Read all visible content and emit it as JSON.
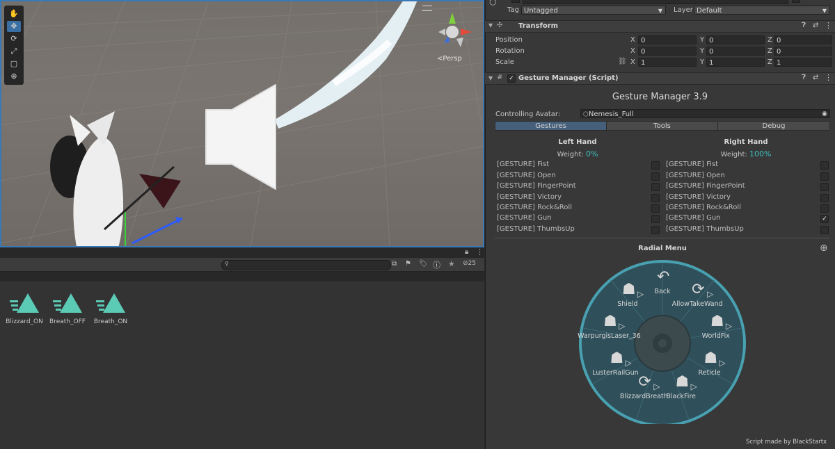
{
  "scene": {
    "persp_label": "Persp",
    "tools": [
      "hand-tool",
      "move-tool",
      "rotate-tool",
      "scale-tool",
      "rect-tool",
      "transform-tool"
    ]
  },
  "project": {
    "hidden_count": "25",
    "assets": [
      {
        "label": "Blizzard_ON"
      },
      {
        "label": "Breath_OFF"
      },
      {
        "label": "Breath_ON"
      }
    ]
  },
  "inspector": {
    "tag_label": "Tag",
    "tag_value": "Untagged",
    "layer_label": "Layer",
    "layer_value": "Default",
    "transform": {
      "title": "Transform",
      "rows": [
        {
          "label": "Position",
          "x": "0",
          "y": "0",
          "z": "0"
        },
        {
          "label": "Rotation",
          "x": "0",
          "y": "0",
          "z": "0"
        },
        {
          "label": "Scale",
          "x": "1",
          "y": "1",
          "z": "1"
        }
      ],
      "axis": {
        "x": "X",
        "y": "Y",
        "z": "Z"
      }
    },
    "gesture": {
      "component_title": "Gesture Manager (Script)",
      "heading": "Gesture Manager 3.9",
      "controlling_label": "Controlling Avatar:",
      "avatar_value": "Nemesis_Full",
      "tabs": [
        "Gestures",
        "Tools",
        "Debug"
      ],
      "left_hand": {
        "title": "Left Hand",
        "weight_label": "Weight:",
        "weight_value": "0%"
      },
      "right_hand": {
        "title": "Right Hand",
        "weight_label": "Weight:",
        "weight_value": "100%"
      },
      "left_gestures": [
        "[GESTURE] Fist",
        "[GESTURE] Open",
        "[GESTURE] FingerPoint",
        "[GESTURE] Victory",
        "[GESTURE] Rock&Roll",
        "[GESTURE] Gun",
        "[GESTURE] ThumbsUp"
      ],
      "right_gestures": [
        "[GESTURE] Fist",
        "[GESTURE] Open",
        "[GESTURE] FingerPoint",
        "[GESTURE] Victory",
        "[GESTURE] Rock&Roll",
        "[GESTURE] Gun",
        "[GESTURE] ThumbsUp"
      ],
      "right_checked_index": 5,
      "radial_title": "Radial Menu",
      "radial_items": [
        "Back",
        "AllowTakeWand",
        "WorldFix",
        "Reticle",
        "BlackFire",
        "BlizzardBreath",
        "LusterRailGun",
        "WarpurgisLaser_36",
        "Shield"
      ],
      "footer": "Script made by BlackStartx"
    }
  },
  "colors": {
    "accent_blue": "#3a79b8",
    "weight_teal": "#3fbfbf",
    "asset_teal": "#5ccbb6",
    "radial_fill": "#2f4f5a",
    "radial_ring": "#48a0b0"
  }
}
